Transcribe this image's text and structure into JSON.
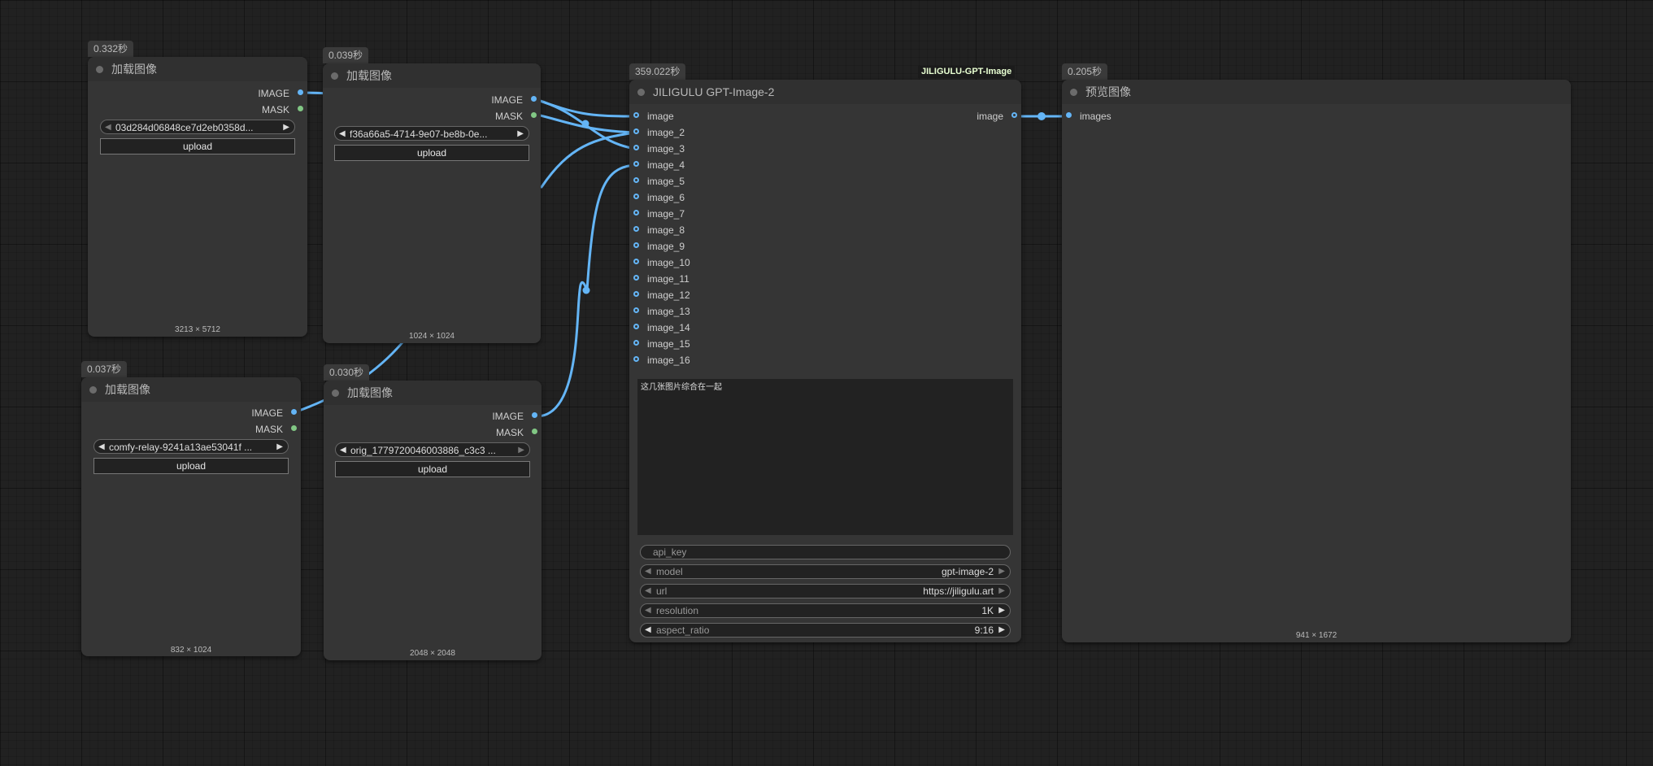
{
  "load_nodes": [
    {
      "id": "load1",
      "time": "0.332秒",
      "title": "加载图像",
      "outputs": [
        "IMAGE",
        "MASK"
      ],
      "file": "03d284d06848ce7d2eb0358d...",
      "button": "upload",
      "dims": "3213 × 5712"
    },
    {
      "id": "load2",
      "time": "0.039秒",
      "title": "加载图像",
      "outputs": [
        "IMAGE",
        "MASK"
      ],
      "file": "f36a66a5-4714-9e07-be8b-0e...",
      "button": "upload",
      "dims": "1024 × 1024"
    },
    {
      "id": "load3",
      "time": "0.037秒",
      "title": "加载图像",
      "outputs": [
        "IMAGE",
        "MASK"
      ],
      "file": "comfy-relay-9241a13ae53041f ...",
      "button": "upload",
      "dims": "832 × 1024"
    },
    {
      "id": "load4",
      "time": "0.030秒",
      "title": "加载图像",
      "outputs": [
        "IMAGE",
        "MASK"
      ],
      "file": "orig_1779720046003886_c3c3 ...",
      "button": "upload",
      "dims": "2048 × 2048"
    }
  ],
  "gpt_node": {
    "time": "359.022秒",
    "extension_label": "JILIGULU-GPT-Image",
    "title": "JILIGULU GPT-Image-2",
    "output": "image",
    "inputs": [
      "image",
      "image_2",
      "image_3",
      "image_4",
      "image_5",
      "image_6",
      "image_7",
      "image_8",
      "image_9",
      "image_10",
      "image_11",
      "image_12",
      "image_13",
      "image_14",
      "image_15",
      "image_16"
    ],
    "prompt": "这几张图片综合在一起",
    "api_key_label": "api_key",
    "model_label": "model",
    "model_value": "gpt-image-2",
    "url_label": "url",
    "url_value": "https://jiligulu.art",
    "resolution_label": "resolution",
    "resolution_value": "1K",
    "aspect_ratio_label": "aspect_ratio",
    "aspect_ratio_value": "9:16"
  },
  "preview_node": {
    "time": "0.205秒",
    "title": "预览图像",
    "input": "images",
    "dims": "941 × 1672"
  },
  "colors": {
    "image_link": "#64b5f6",
    "mask_slot": "#81c784",
    "node_bg": "#353535",
    "canvas_bg": "#212121"
  }
}
